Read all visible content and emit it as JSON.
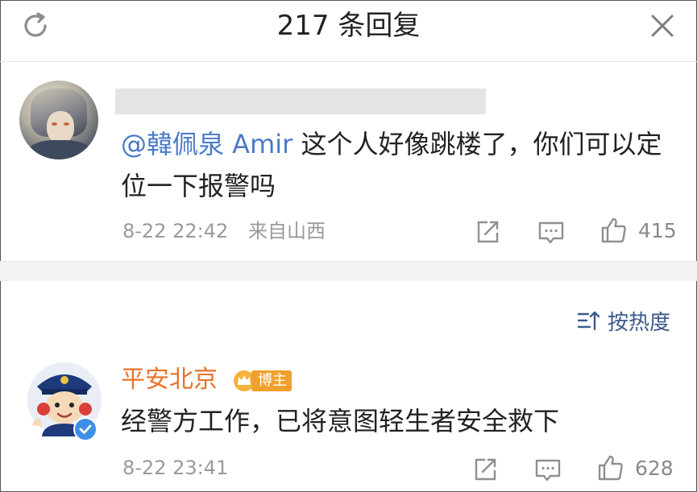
{
  "header": {
    "title": "217 条回复",
    "refresh_icon": "refresh-icon",
    "close_icon": "close-icon"
  },
  "comments": [
    {
      "username": "",
      "avatar": "anime-character-avatar",
      "mention": "@韓佩泉 Amir",
      "text": " 这个人好像跳楼了，你们可以定位一下报警吗",
      "time": "8-22 22:42",
      "source": "来自山西",
      "likes": "415"
    },
    {
      "username": "平安北京",
      "avatar": "police-mascot-avatar",
      "badge": "博主",
      "verified": true,
      "text": "经警方工作，已将意图轻生者安全救下",
      "time": "8-22 23:41",
      "likes": "628"
    }
  ],
  "sort": {
    "label": "按热度"
  },
  "colors": {
    "mention": "#4b7ac7",
    "username": "#e8732a",
    "badge": "#f0a02c",
    "meta": "#9a9a9a",
    "verified": "#3f8ee8"
  }
}
